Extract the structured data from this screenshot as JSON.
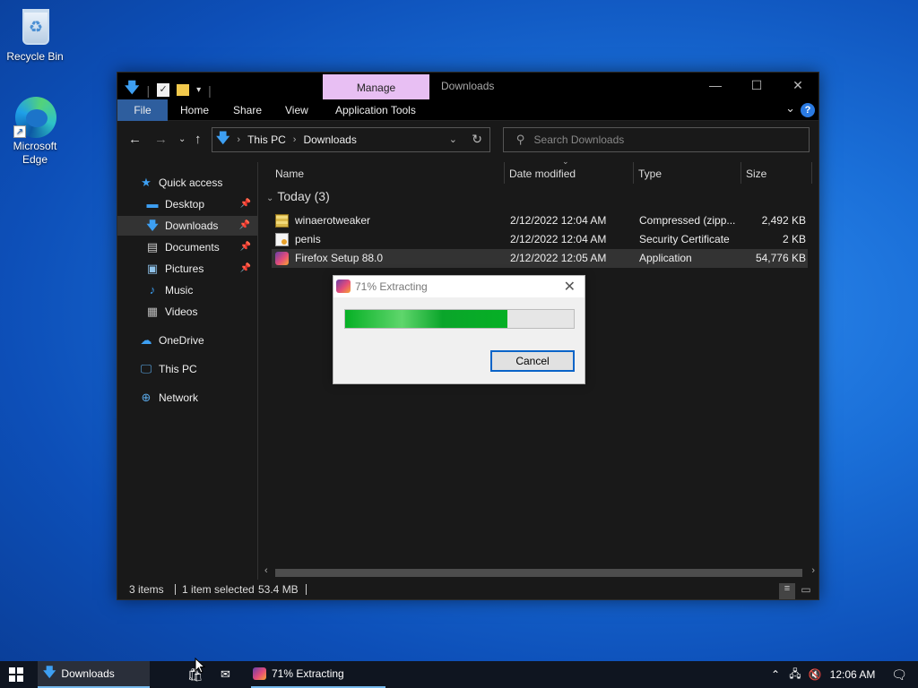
{
  "desktop": {
    "icons": [
      {
        "label": "Recycle Bin"
      },
      {
        "label": "Microsoft Edge"
      }
    ]
  },
  "explorer": {
    "title": "Downloads",
    "manage_tab": "Manage",
    "ribbon_tabs": [
      "File",
      "Home",
      "Share",
      "View",
      "Application Tools"
    ],
    "address": {
      "crumbs": [
        "This PC",
        "Downloads"
      ]
    },
    "search": {
      "placeholder": "Search Downloads"
    },
    "nav": [
      {
        "label": "Quick access",
        "icon": "star-icon"
      },
      {
        "label": "Desktop",
        "icon": "desktop-icon",
        "pinned": true
      },
      {
        "label": "Downloads",
        "icon": "download-arrow-icon",
        "pinned": true,
        "selected": true
      },
      {
        "label": "Documents",
        "icon": "document-icon",
        "pinned": true
      },
      {
        "label": "Pictures",
        "icon": "pictures-icon",
        "pinned": true
      },
      {
        "label": "Music",
        "icon": "music-icon"
      },
      {
        "label": "Videos",
        "icon": "videos-icon"
      },
      {
        "label": "OneDrive",
        "icon": "cloud-icon"
      },
      {
        "label": "This PC",
        "icon": "computer-icon"
      },
      {
        "label": "Network",
        "icon": "network-icon"
      }
    ],
    "columns": [
      "Name",
      "Date modified",
      "Type",
      "Size"
    ],
    "group": "Today (3)",
    "files": [
      {
        "name": "winaerotweaker",
        "date": "2/12/2022 12:04 AM",
        "type": "Compressed (zipp...",
        "size": "2,492 KB",
        "icon": "zip-folder-icon"
      },
      {
        "name": "penis",
        "date": "2/12/2022 12:04 AM",
        "type": "Security Certificate",
        "size": "2 KB",
        "icon": "certificate-icon"
      },
      {
        "name": "Firefox Setup 88.0",
        "date": "2/12/2022 12:05 AM",
        "type": "Application",
        "size": "54,776 KB",
        "icon": "installer-icon",
        "selected": true
      }
    ],
    "status": {
      "items": "3 items",
      "selected": "1 item selected",
      "size": "53.4 MB"
    }
  },
  "dialog": {
    "title": "71% Extracting",
    "progress": 0.71,
    "cancel_label": "Cancel"
  },
  "taskbar": {
    "items": [
      {
        "label": "Downloads",
        "active": true
      },
      {
        "label": "71% Extracting"
      }
    ],
    "clock": "12:06 AM"
  }
}
